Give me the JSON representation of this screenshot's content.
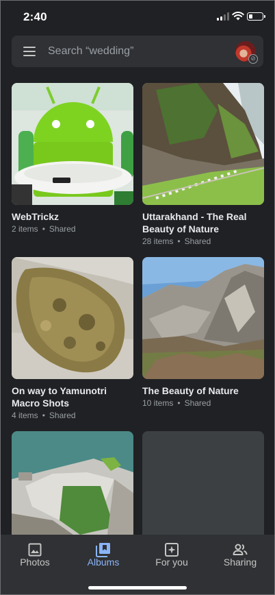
{
  "status_bar": {
    "time": "2:40"
  },
  "search": {
    "placeholder": "Search “wedding”"
  },
  "albums": [
    {
      "title": "WebTrickz",
      "count": "2 items",
      "shared": "Shared"
    },
    {
      "title": "Uttarakhand - The Real Beauty of Nature",
      "count": "28 items",
      "shared": "Shared"
    },
    {
      "title": "On way to Yamunotri Macro Shots",
      "count": "4 items",
      "shared": "Shared"
    },
    {
      "title": "The Beauty of Nature",
      "count": "10 items",
      "shared": "Shared"
    }
  ],
  "separator": "•",
  "bottom_nav": [
    {
      "label": "Photos",
      "icon": "photo-icon",
      "active": false
    },
    {
      "label": "Albums",
      "icon": "album-icon",
      "active": true
    },
    {
      "label": "For you",
      "icon": "for-you-icon",
      "active": false
    },
    {
      "label": "Sharing",
      "icon": "sharing-icon",
      "active": false
    }
  ],
  "colors": {
    "background": "#202124",
    "surface": "#303134",
    "accent": "#8ab4f8"
  }
}
